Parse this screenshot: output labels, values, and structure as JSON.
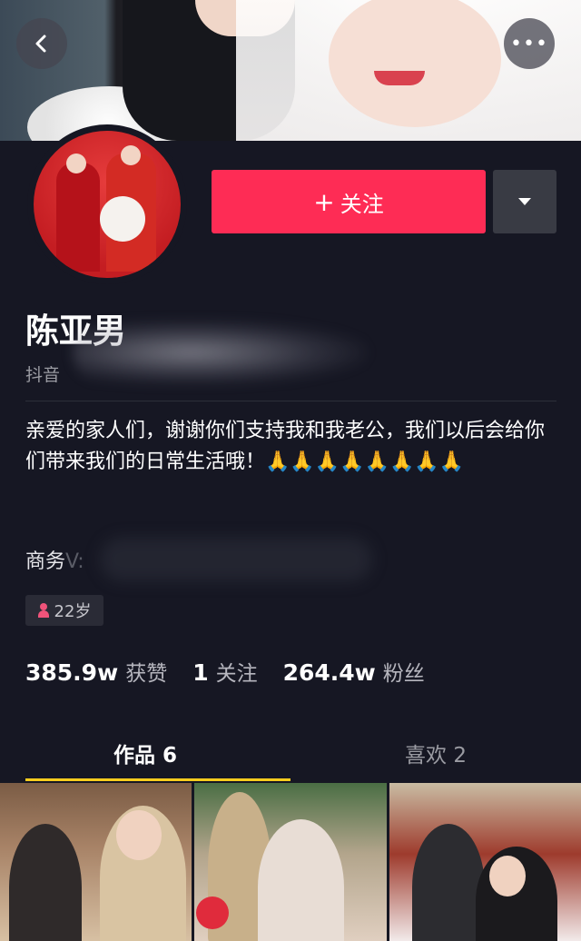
{
  "header": {
    "back_icon": "chevron-left-icon",
    "more_icon": "more-horizontal-icon",
    "more_glyph": "•••"
  },
  "profile": {
    "name": "陈亚男",
    "douyin_prefix": "抖音",
    "follow_label": "关注",
    "follow_plus": "+",
    "bio": "亲爱的家人们，谢谢你们支持我和我老公，我们以后会给你们带来我们的日常生活哦！🙏🙏🙏🙏🙏🙏🙏🙏",
    "business_label": "商务",
    "business_v": "V:",
    "age_tag": "22岁"
  },
  "stats": [
    {
      "value": "385.9w",
      "label": "获赞"
    },
    {
      "value": "1",
      "label": "关注"
    },
    {
      "value": "264.4w",
      "label": "粉丝"
    }
  ],
  "tabs": {
    "works": "作品 6",
    "likes": "喜欢 2"
  },
  "colors": {
    "background": "#161723",
    "follow": "#fe2c55",
    "tab_underline": "#facd1e",
    "age_icon": "#f0537a"
  }
}
